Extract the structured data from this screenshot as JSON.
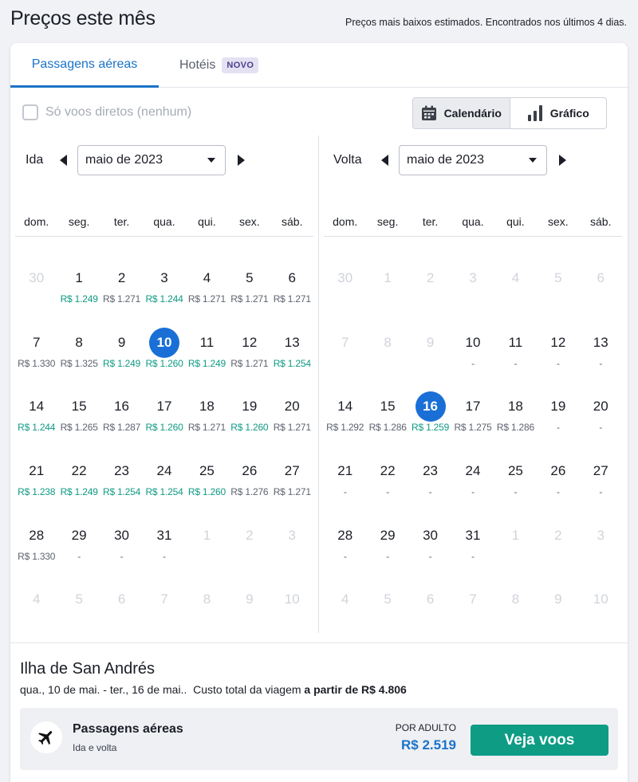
{
  "header": {
    "title": "Preços este mês",
    "subtitle": "Preços mais baixos estimados. Encontrados nos últimos 4 dias."
  },
  "tabs": {
    "flights": "Passagens aéreas",
    "hotels": "Hotéis",
    "hotels_badge": "NOVO"
  },
  "filter": {
    "direct_only": "Só voos diretos (nenhum)",
    "checked": false
  },
  "view_toggle": {
    "calendar": "Calendário",
    "chart": "Gráfico",
    "active": "calendar"
  },
  "colors": {
    "accent": "#1a73c8",
    "low_price": "#0f9a84",
    "cta": "#0e9c85",
    "selected_day": "#1a6fd6"
  },
  "weekdays": [
    "dom.",
    "seg.",
    "ter.",
    "qua.",
    "qui.",
    "sex.",
    "sáb."
  ],
  "departure": {
    "label": "Ida",
    "month": "maio de 2023",
    "days": [
      {
        "d": "30",
        "m": true
      },
      {
        "d": "1",
        "p": "R$ 1.249",
        "low": true
      },
      {
        "d": "2",
        "p": "R$ 1.271"
      },
      {
        "d": "3",
        "p": "R$ 1.244",
        "low": true
      },
      {
        "d": "4",
        "p": "R$ 1.271"
      },
      {
        "d": "5",
        "p": "R$ 1.271"
      },
      {
        "d": "6",
        "p": "R$ 1.271"
      },
      {
        "d": "7",
        "p": "R$ 1.330"
      },
      {
        "d": "8",
        "p": "R$ 1.325"
      },
      {
        "d": "9",
        "p": "R$ 1.249",
        "low": true
      },
      {
        "d": "10",
        "p": "R$ 1.260",
        "low": true,
        "sel": true
      },
      {
        "d": "11",
        "p": "R$ 1.249",
        "low": true
      },
      {
        "d": "12",
        "p": "R$ 1.271"
      },
      {
        "d": "13",
        "p": "R$ 1.254",
        "low": true
      },
      {
        "d": "14",
        "p": "R$ 1.244",
        "low": true
      },
      {
        "d": "15",
        "p": "R$ 1.265"
      },
      {
        "d": "16",
        "p": "R$ 1.287"
      },
      {
        "d": "17",
        "p": "R$ 1.260",
        "low": true
      },
      {
        "d": "18",
        "p": "R$ 1.271"
      },
      {
        "d": "19",
        "p": "R$ 1.260",
        "low": true
      },
      {
        "d": "20",
        "p": "R$ 1.271"
      },
      {
        "d": "21",
        "p": "R$ 1.238",
        "low": true
      },
      {
        "d": "22",
        "p": "R$ 1.249",
        "low": true
      },
      {
        "d": "23",
        "p": "R$ 1.254",
        "low": true
      },
      {
        "d": "24",
        "p": "R$ 1.254",
        "low": true
      },
      {
        "d": "25",
        "p": "R$ 1.260",
        "low": true
      },
      {
        "d": "26",
        "p": "R$ 1.276"
      },
      {
        "d": "27",
        "p": "R$ 1.271"
      },
      {
        "d": "28",
        "p": "R$ 1.330"
      },
      {
        "d": "29",
        "p": "-"
      },
      {
        "d": "30",
        "p": "-"
      },
      {
        "d": "31",
        "p": "-"
      },
      {
        "d": "1",
        "m": true
      },
      {
        "d": "2",
        "m": true
      },
      {
        "d": "3",
        "m": true
      },
      {
        "d": "4",
        "m": true
      },
      {
        "d": "5",
        "m": true
      },
      {
        "d": "6",
        "m": true
      },
      {
        "d": "7",
        "m": true
      },
      {
        "d": "8",
        "m": true
      },
      {
        "d": "9",
        "m": true
      },
      {
        "d": "10",
        "m": true
      }
    ]
  },
  "return": {
    "label": "Volta",
    "month": "maio de 2023",
    "days": [
      {
        "d": "30",
        "m": true
      },
      {
        "d": "1",
        "m": true
      },
      {
        "d": "2",
        "m": true
      },
      {
        "d": "3",
        "m": true
      },
      {
        "d": "4",
        "m": true
      },
      {
        "d": "5",
        "m": true
      },
      {
        "d": "6",
        "m": true
      },
      {
        "d": "7",
        "m": true
      },
      {
        "d": "8",
        "m": true
      },
      {
        "d": "9",
        "m": true
      },
      {
        "d": "10",
        "p": "-"
      },
      {
        "d": "11",
        "p": "-"
      },
      {
        "d": "12",
        "p": "-"
      },
      {
        "d": "13",
        "p": "-"
      },
      {
        "d": "14",
        "p": "R$ 1.292"
      },
      {
        "d": "15",
        "p": "R$ 1.286"
      },
      {
        "d": "16",
        "p": "R$ 1.259",
        "low": true,
        "sel": true
      },
      {
        "d": "17",
        "p": "R$ 1.275"
      },
      {
        "d": "18",
        "p": "R$ 1.286"
      },
      {
        "d": "19",
        "p": "-"
      },
      {
        "d": "20",
        "p": "-"
      },
      {
        "d": "21",
        "p": "-"
      },
      {
        "d": "22",
        "p": "-"
      },
      {
        "d": "23",
        "p": "-"
      },
      {
        "d": "24",
        "p": "-"
      },
      {
        "d": "25",
        "p": "-"
      },
      {
        "d": "26",
        "p": "-"
      },
      {
        "d": "27",
        "p": "-"
      },
      {
        "d": "28",
        "p": "-"
      },
      {
        "d": "29",
        "p": "-"
      },
      {
        "d": "30",
        "p": "-"
      },
      {
        "d": "31",
        "p": "-"
      },
      {
        "d": "1",
        "m": true
      },
      {
        "d": "2",
        "m": true
      },
      {
        "d": "3",
        "m": true
      },
      {
        "d": "4",
        "m": true
      },
      {
        "d": "5",
        "m": true
      },
      {
        "d": "6",
        "m": true
      },
      {
        "d": "7",
        "m": true
      },
      {
        "d": "8",
        "m": true
      },
      {
        "d": "9",
        "m": true
      },
      {
        "d": "10",
        "m": true
      }
    ]
  },
  "summary": {
    "destination": "Ilha de San Andrés",
    "dates": "qua., 10 de mai. - ter., 16 de mai..",
    "total_label": "Custo total da viagem",
    "total_value": "a partir de R$ 4.806",
    "flight_title": "Passagens aéreas",
    "flight_sub": "Ida e volta",
    "per_adult": "POR ADULTO",
    "price": "R$ 2.519",
    "cta": "Veja voos"
  }
}
